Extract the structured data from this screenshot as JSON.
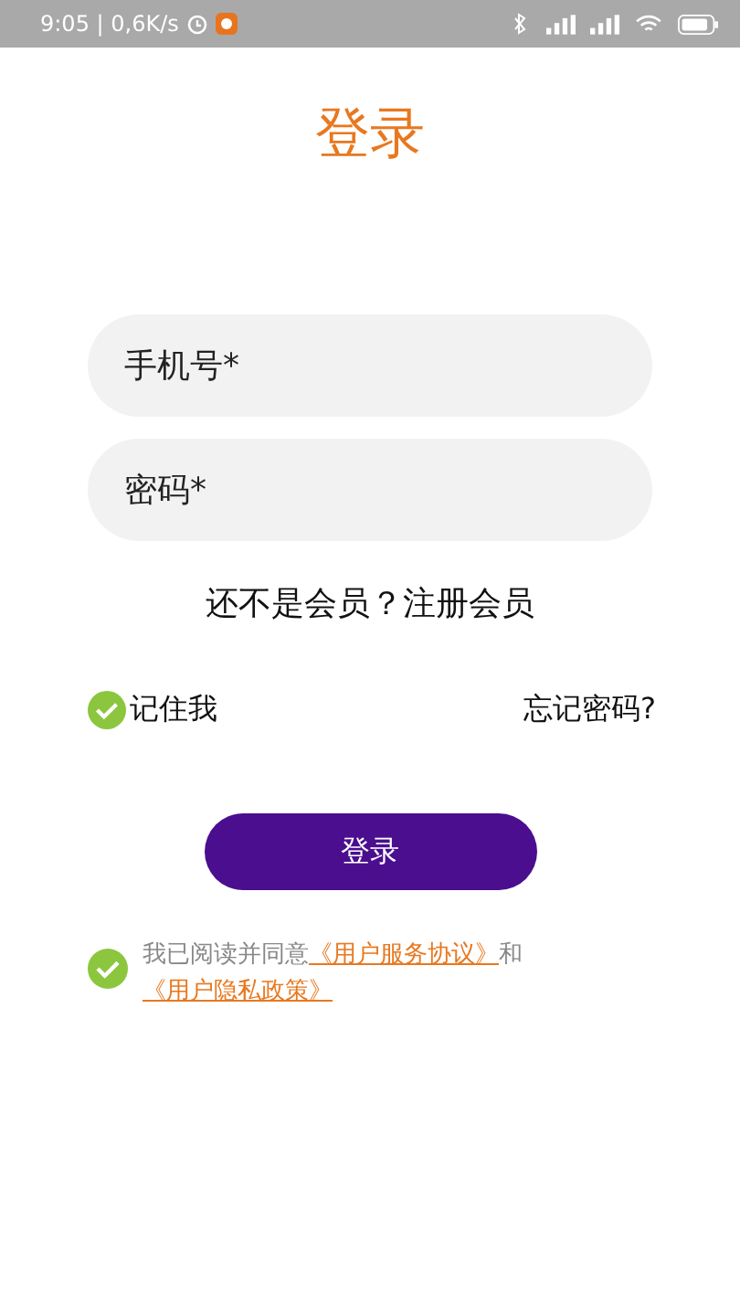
{
  "status_bar": {
    "time_and_speed": "9:05 | 0,6K/s"
  },
  "title": "登录",
  "fields": [
    {
      "placeholder": "手机号*"
    },
    {
      "placeholder": "密码*"
    }
  ],
  "register_prompt": "还不是会员？注册会员",
  "remember": {
    "label": "记住我",
    "checked": true
  },
  "forgot": "忘记密码?",
  "login_button": "登录",
  "agreement": {
    "checked": true,
    "prefix": "我已阅读并同意",
    "link_1": "《用户服务协议》",
    "joiner": "和",
    "link_2": "《用户隐私政策》"
  }
}
